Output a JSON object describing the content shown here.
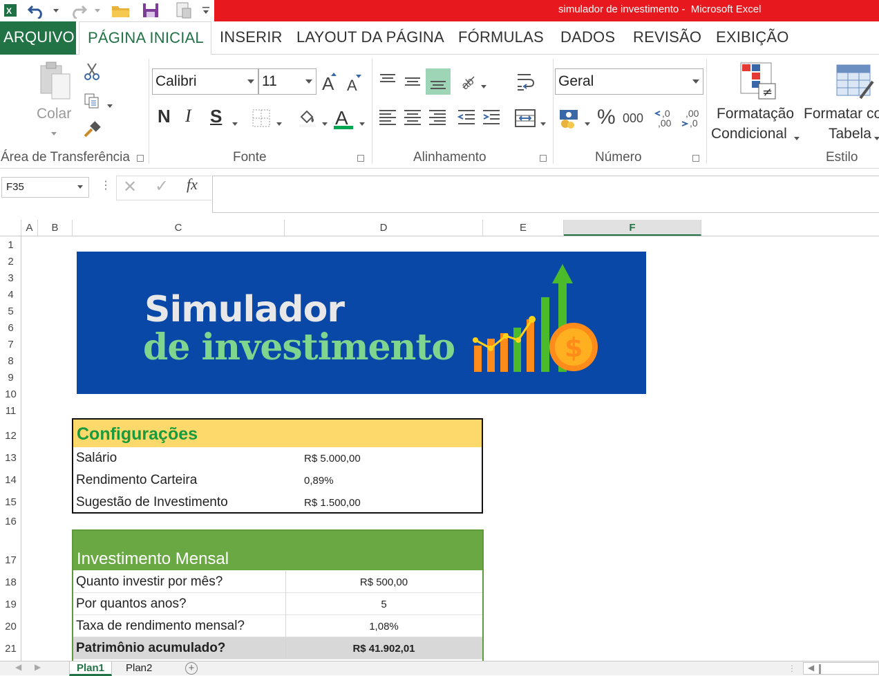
{
  "window": {
    "title": "simulador de investimento -  Microsoft Excel"
  },
  "quick_access": [
    "excel-logo-icon",
    "undo-icon",
    "redo-icon",
    "open-folder-icon",
    "save-icon",
    "print-preview-icon",
    "customize-icon"
  ],
  "tabs": [
    {
      "label": "ARQUIVO"
    },
    {
      "label": "PÁGINA INICIAL"
    },
    {
      "label": "INSERIR"
    },
    {
      "label": "LAYOUT DA PÁGINA"
    },
    {
      "label": "FÓRMULAS"
    },
    {
      "label": "DADOS"
    },
    {
      "label": "REVISÃO"
    },
    {
      "label": "EXIBIÇÃO"
    }
  ],
  "ribbon": {
    "clipboard": {
      "paste_label": "Colar",
      "group_label": "Área de Transferência"
    },
    "font": {
      "font_name": "Calibri",
      "font_size": "11",
      "bold": "N",
      "italic": "I",
      "underline": "S",
      "group_label": "Fonte",
      "font_color": "#00a651"
    },
    "alignment": {
      "group_label": "Alinhamento"
    },
    "number": {
      "format": "Geral",
      "percent": "%",
      "thousands": "000",
      "group_label": "Número"
    },
    "styles": {
      "cond_format_line1": "Formatação",
      "cond_format_line2": "Condicional",
      "format_table_line1": "Formatar co",
      "format_table_line2": "Tabela",
      "group_label": "Estilo"
    }
  },
  "formula_bar": {
    "name_box": "F35",
    "fx": "fx",
    "formula": ""
  },
  "columns": [
    "A",
    "B",
    "C",
    "D",
    "E",
    "F"
  ],
  "rows": [
    "1",
    "2",
    "3",
    "4",
    "5",
    "6",
    "7",
    "8",
    "9",
    "10",
    "11",
    "12",
    "13",
    "14",
    "15",
    "16",
    "17",
    "18",
    "19",
    "20",
    "21"
  ],
  "banner": {
    "line1": "Simulador",
    "line2": "de investimento"
  },
  "config": {
    "title": "Configurações",
    "rows": [
      {
        "label": "Salário",
        "value": "R$ 5.000,00"
      },
      {
        "label": "Rendimento Carteira",
        "value": "0,89%"
      },
      {
        "label": "Sugestão de Investimento",
        "value": "R$ 1.500,00"
      }
    ]
  },
  "investment": {
    "title": "Investimento Mensal",
    "rows": [
      {
        "label": "Quanto investir por mês?",
        "value": "R$ 500,00"
      },
      {
        "label": "Por quantos anos?",
        "value": "5"
      },
      {
        "label": "Taxa de rendimento mensal?",
        "value": "1,08%"
      },
      {
        "label": "Patrimônio acumulado?",
        "value": "R$ 41.902,01"
      }
    ]
  },
  "sheets": [
    {
      "label": "Plan1"
    },
    {
      "label": "Plan2"
    }
  ]
}
